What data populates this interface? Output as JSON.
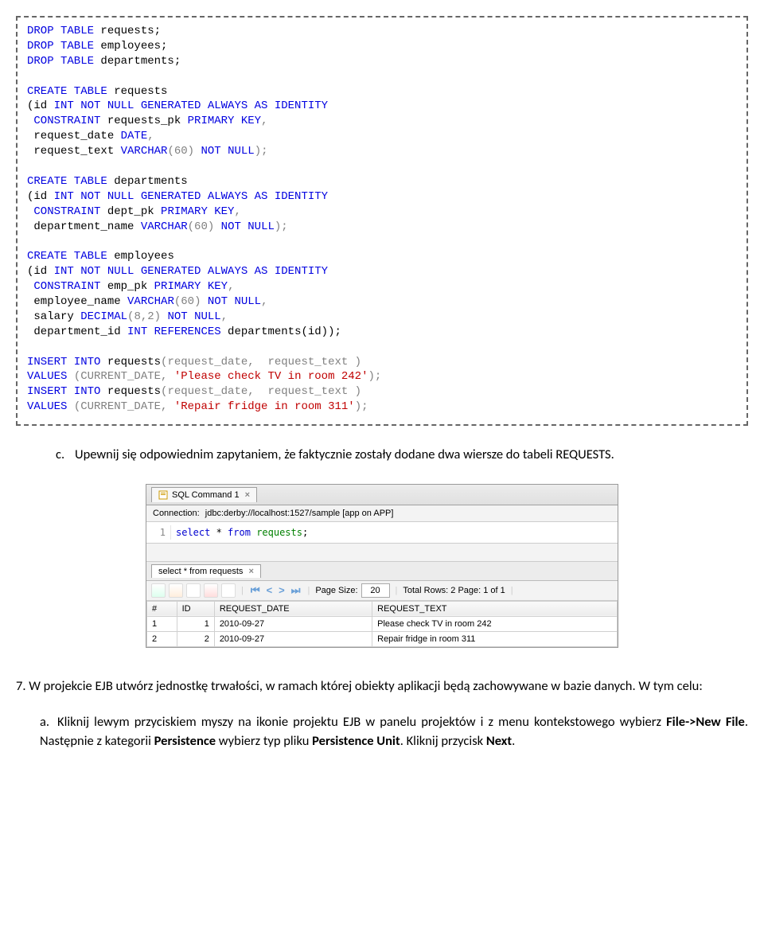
{
  "code": {
    "l1a": "DROP TABLE",
    "l1b": " requests;",
    "l2a": "DROP TABLE",
    "l2b": " employees;",
    "l3a": "DROP TABLE",
    "l3b": " departments;",
    "l5a": "CREATE TABLE",
    "l5b": " requests",
    "l6a": "(id ",
    "l6b": "INT NOT NULL GENERATED ALWAYS AS IDENTITY",
    "l7a": " CONSTRAINT",
    "l7b": " requests_pk ",
    "l7c": "PRIMARY KEY",
    "l8a": " request_date ",
    "l8b": "DATE",
    "l9a": " request_text ",
    "l9b": "VARCHAR",
    "l9c": "60",
    "l9d": "NOT NULL",
    "l11a": "CREATE TABLE",
    "l11b": " departments",
    "l12a": "(id ",
    "l12b": "INT NOT NULL GENERATED ALWAYS AS IDENTITY",
    "l13a": " CONSTRAINT",
    "l13b": " dept_pk ",
    "l13c": "PRIMARY KEY",
    "l14a": " department_name ",
    "l14b": "VARCHAR",
    "l14c": "60",
    "l14d": "NOT NULL",
    "l16a": "CREATE TABLE",
    "l16b": " employees",
    "l17a": "(id ",
    "l17b": "INT NOT NULL GENERATED ALWAYS AS IDENTITY",
    "l18a": " CONSTRAINT",
    "l18b": " emp_pk ",
    "l18c": "PRIMARY KEY",
    "l19a": " employee_name ",
    "l19b": "VARCHAR",
    "l19c": "60",
    "l19d": "NOT NULL",
    "l20a": " salary ",
    "l20b": "DECIMAL",
    "l20c": "8",
    "l20d": "2",
    "l20e": "NOT NULL",
    "l21a": " department_id ",
    "l21b": "INT REFERENCES",
    "l21c": " departments(id));",
    "l23a": "INSERT INTO",
    "l23b": " requests",
    "l23c": "(request_date,  request_text )",
    "l24a": "VALUES ",
    "l24b": "(CURRENT_DATE, ",
    "l24c": "'Please check TV in room 242'",
    "l24d": ");",
    "l25a": "INSERT INTO",
    "l25b": " requests",
    "l25c": "(request_date,  request_text )",
    "l26a": "VALUES ",
    "l26b": "(CURRENT_DATE, ",
    "l26c": "'Repair fridge in room 311'",
    "l26d": ");",
    "comma": ",",
    "paren_o": "(",
    "paren_c": ")",
    "paren_sc": ");"
  },
  "text": {
    "c_marker": "c.",
    "c_body": "Upewnij się odpowiednim zapytaniem, że faktycznie zostały dodane dwa wiersze do tabeli REQUESTS.",
    "p7": "7.  W  projekcie  EJB  utwórz  jednostkę  trwałości,  w  ramach  której  obiekty  aplikacji  będą zachowywane w bazie danych. W tym celu:",
    "a_marker": "a.",
    "a_1": "Kliknij  lewym  przyciskiem myszy  na  ikonie  projektu  EJB  w  panelu  projektów i  z  menu kontekstowego wybierz ",
    "a_b1": "File->New File",
    "a_2": ". Następnie z kategorii ",
    "a_b2": "Persistence",
    "a_3": " wybierz typ pliku ",
    "a_b3": "Persistence Unit",
    "a_4": ". Kliknij przycisk ",
    "a_b4": "Next",
    "a_5": "."
  },
  "ide": {
    "tab_label": "SQL Command 1",
    "conn_label": "Connection:",
    "conn_value": "jdbc:derby://localhost:1527/sample [app on APP]",
    "line_no": "1",
    "sql_select": "select",
    "sql_star": " * ",
    "sql_from": "from",
    "sql_sp": " ",
    "sql_table": "requests",
    "sql_semi": ";",
    "res_tab": "select * from requests",
    "page_size_label": "Page Size:",
    "page_size_value": "20",
    "total_rows": "Total Rows: 2  Page: 1 of 1",
    "cols": [
      "#",
      "ID",
      "REQUEST_DATE",
      "REQUEST_TEXT"
    ],
    "rows": [
      {
        "n": "1",
        "id": "1",
        "date": "2010-09-27",
        "text": "Please check TV in room 242"
      },
      {
        "n": "2",
        "id": "2",
        "date": "2010-09-27",
        "text": "Repair fridge in room 311"
      }
    ]
  }
}
